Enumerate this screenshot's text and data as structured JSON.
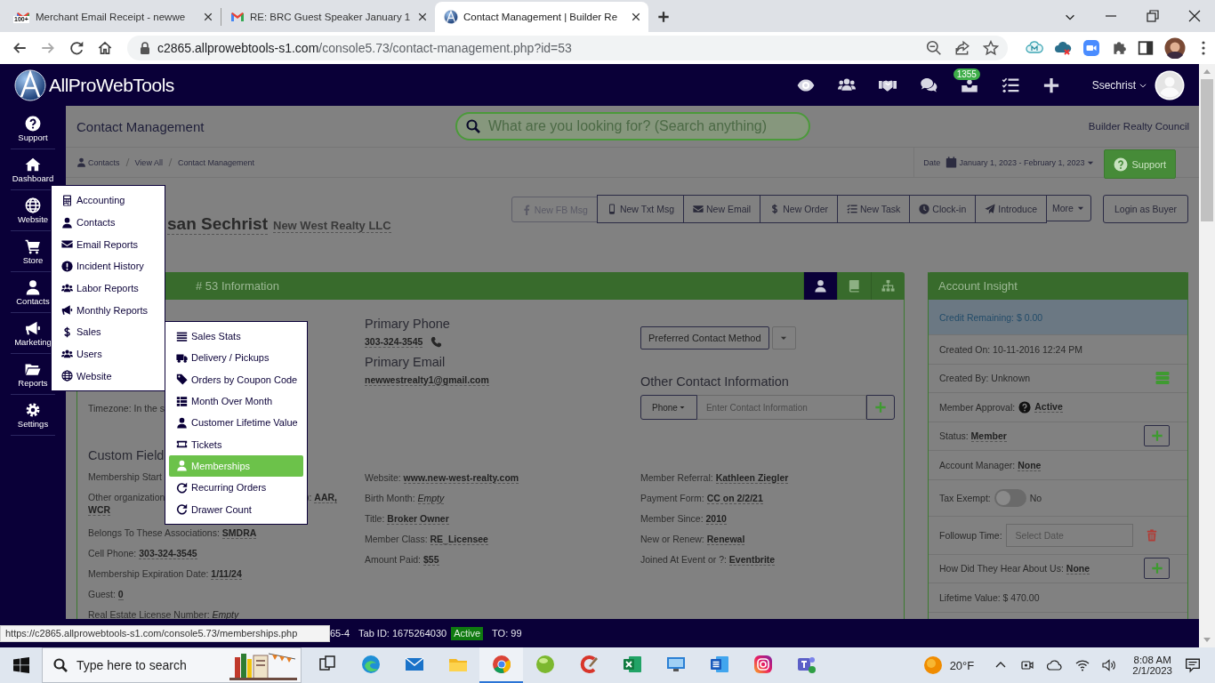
{
  "browser": {
    "tabs": [
      {
        "title": "Merchant Email Receipt - newwe",
        "badge": "100+",
        "selected": false
      },
      {
        "title": "RE: BRC Guest Speaker January 1",
        "selected": false
      },
      {
        "title": "Contact Management | Builder Re",
        "selected": true
      }
    ],
    "address": {
      "host": "c2865.allprowebtools-s1.com",
      "path": "/console5.73/contact-management.php?id=53"
    }
  },
  "header": {
    "logo": "AllProWebTools",
    "badge": "1355",
    "user": "Ssechrist"
  },
  "sidebar": {
    "items": [
      {
        "label": "Support"
      },
      {
        "label": "Dashboard"
      },
      {
        "label": "Website"
      },
      {
        "label": "Store"
      },
      {
        "label": "Contacts"
      },
      {
        "label": "Marketing"
      },
      {
        "label": "Reports"
      },
      {
        "label": "Settings"
      }
    ]
  },
  "website_menu": {
    "items": [
      {
        "label": "Accounting"
      },
      {
        "label": "Contacts"
      },
      {
        "label": "Email Reports"
      },
      {
        "label": "Incident History"
      },
      {
        "label": "Labor Reports"
      },
      {
        "label": "Monthly Reports"
      },
      {
        "label": "Sales"
      },
      {
        "label": "Users"
      },
      {
        "label": "Website"
      }
    ]
  },
  "sales_menu": {
    "items": [
      {
        "label": "Sales Stats",
        "selected": false
      },
      {
        "label": "Delivery / Pickups",
        "selected": false
      },
      {
        "label": "Orders by Coupon Code",
        "selected": false
      },
      {
        "label": "Month Over Month",
        "selected": false
      },
      {
        "label": "Customer Lifetime Value",
        "selected": false
      },
      {
        "label": "Tickets",
        "selected": false
      },
      {
        "label": "Memberships",
        "selected": true
      },
      {
        "label": "Recurring Orders",
        "selected": false
      },
      {
        "label": "Drawer Count",
        "selected": false
      }
    ]
  },
  "page": {
    "title": "Contact Management",
    "search_placeholder": "What are you looking for? (Search anything)",
    "org": "Builder Realty Council",
    "breadcrumb": [
      "Contacts",
      "View All",
      "Contact Management"
    ],
    "date_label": "Date",
    "date_range": "January 1, 2023 - February 1, 2023",
    "support": "Support"
  },
  "contact": {
    "name": "san Sechrist",
    "company": "New West Realty LLC",
    "actions": [
      {
        "label": "New FB Msg",
        "disabled": true
      },
      {
        "label": "New Txt Msg",
        "disabled": false
      },
      {
        "label": "New Email",
        "disabled": false
      },
      {
        "label": "New Order",
        "disabled": false
      },
      {
        "label": "New Task",
        "disabled": false
      },
      {
        "label": "Clock-in",
        "disabled": false
      },
      {
        "label": "Introduce",
        "disabled": false
      }
    ],
    "more": "More",
    "login": "Login as Buyer"
  },
  "info": {
    "title": "# 53 Information",
    "view_tabs": [
      {
        "selected": true
      },
      {
        "selected": false
      },
      {
        "selected": false
      }
    ],
    "timezone": "Timezone: In the s",
    "primary_phone_label": "Primary Phone",
    "primary_phone": "303-324-3545",
    "primary_email_label": "Primary Email",
    "primary_email": "newwestrealty1@gmail.com",
    "preferred": "Preferred Contact Method",
    "other_heading": "Other Contact Information",
    "other_type": "Phone",
    "other_placeholder": "Enter Contact Information",
    "custom_heading": "Custom Field",
    "custom_columns": [
      [
        {
          "label": "Membership Start"
        },
        {
          "label": "Other organization",
          "label_end": "):",
          "value": "AAR,",
          "value_wrap": "WCR",
          "empty": false
        },
        {
          "label": "Belongs To These Associations:",
          "value": "SMDRA",
          "empty": false
        },
        {
          "label": "Cell Phone:",
          "value": "303-324-3545",
          "empty": false
        },
        {
          "label": "Membership Expiration Date:",
          "value": "1/11/24",
          "empty": false
        },
        {
          "label": "Guest:",
          "value": "0",
          "empty": false
        },
        {
          "label": "Real Estate License Number:",
          "value": "Empty",
          "empty": true
        }
      ],
      [
        {
          "label": "Website:",
          "value": "www.new-west-realty.com",
          "empty": false
        },
        {
          "label": "Birth Month:",
          "value": "Empty",
          "empty": true
        },
        {
          "label": "Title:",
          "value": "Broker Owner",
          "empty": false
        },
        {
          "label": "Member Class:",
          "value": "RE_Licensee",
          "empty": false
        },
        {
          "label": "Amount Paid:",
          "value": "$55",
          "empty": false
        }
      ],
      [
        {
          "label": "Member Referral:",
          "value": "Kathleen Ziegler",
          "empty": false
        },
        {
          "label": "Payment Form:",
          "value": "CC on 2/2/21",
          "empty": false
        },
        {
          "label": "Member Since:",
          "value": "2010",
          "empty": false
        },
        {
          "label": "New or Renew:",
          "value": "Renewal",
          "empty": false
        },
        {
          "label": "Joined At Event or ?:",
          "value": "Eventbrite",
          "empty": false
        }
      ]
    ]
  },
  "insight": {
    "title": "Account Insight",
    "rows": [
      {
        "kind": "credit",
        "label": "Credit Remaining: $ 0.00"
      },
      {
        "kind": "plain",
        "label": "Created On: 10-11-2016 12:24 PM"
      },
      {
        "kind": "plain",
        "label": "Created By: Unknown",
        "list_button": true
      },
      {
        "kind": "value",
        "label": "Member Approval:",
        "value": "Active",
        "help_icon": true
      },
      {
        "kind": "value",
        "label": "Status:",
        "value": "Member",
        "add_button": true
      },
      {
        "kind": "value",
        "label": "Account Manager:",
        "value": "None"
      },
      {
        "kind": "toggle",
        "label": "Tax Exempt:",
        "on": false,
        "state_text": "No"
      },
      {
        "kind": "date",
        "label": "Followup Time:",
        "placeholder": "Select Date",
        "delete_button": true
      },
      {
        "kind": "value",
        "label": "How Did They Hear About Us:",
        "value": "None",
        "add_button": true
      },
      {
        "kind": "plain",
        "label": "Lifetime Value: $ 470.00"
      }
    ]
  },
  "status_bar": {
    "link_preview": "https://c2865.allprowebtools-s1.com/console5.73/memberships.php",
    "session": "65-4",
    "tab_id": "Tab ID: 1675264030",
    "state": "Active",
    "timeout": "TO: 99"
  },
  "taskbar": {
    "search_placeholder": "Type here to search",
    "apps": [
      {
        "selected": false
      },
      {
        "selected": false
      },
      {
        "selected": false
      },
      {
        "selected": false
      },
      {
        "selected": true
      },
      {
        "selected": false
      },
      {
        "selected": false
      },
      {
        "selected": false
      },
      {
        "selected": false
      },
      {
        "selected": false
      },
      {
        "selected": false
      },
      {
        "selected": false
      }
    ],
    "weather": "20°F",
    "time": "8:08 AM",
    "date": "2/1/2023"
  }
}
